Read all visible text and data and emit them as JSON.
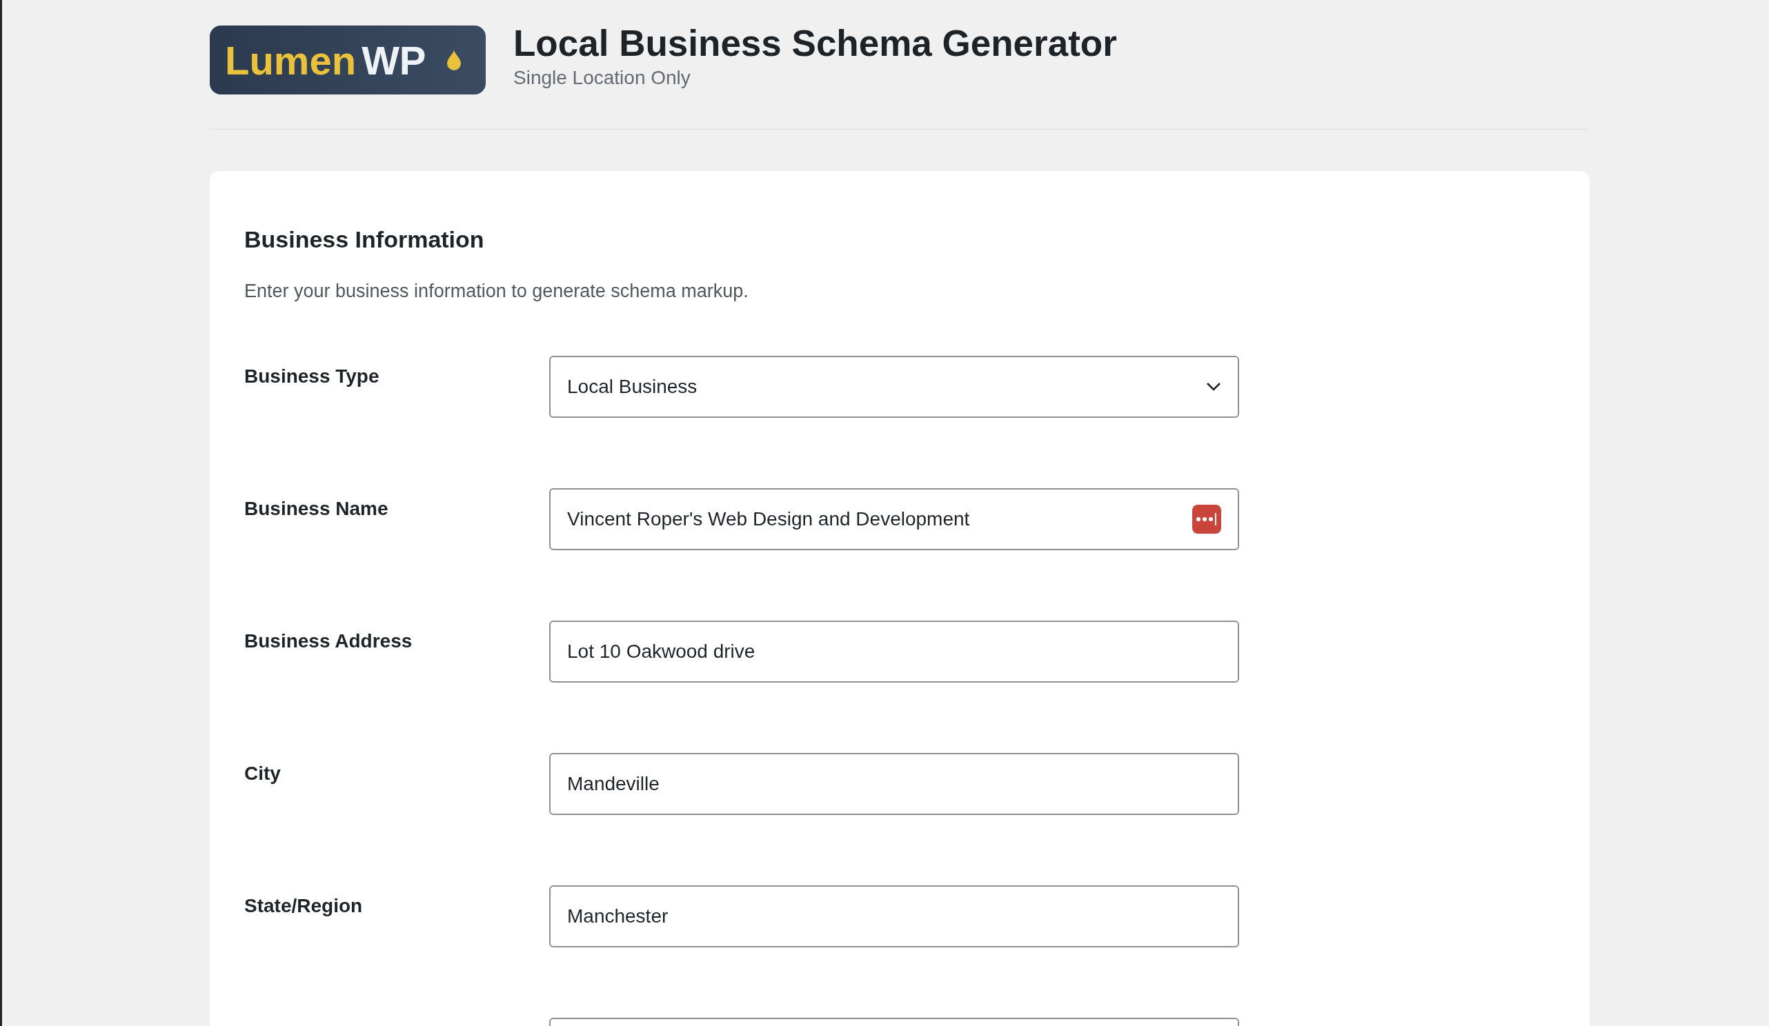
{
  "logo": {
    "word_1": "Lumen",
    "word_2": "WP"
  },
  "header": {
    "title": "Local Business Schema Generator",
    "subtitle": "Single Location Only"
  },
  "section": {
    "title": "Business Information",
    "description": "Enter your business information to generate schema markup."
  },
  "fields": [
    {
      "kind": "select",
      "label": "Business Type",
      "value": "Local Business",
      "autofill_icon": false
    },
    {
      "kind": "text",
      "label": "Business Name",
      "value": "Vincent Roper's Web Design and Development",
      "autofill_icon": true
    },
    {
      "kind": "text",
      "label": "Business Address",
      "value": "Lot 10 Oakwood drive",
      "autofill_icon": false
    },
    {
      "kind": "text",
      "label": "City",
      "value": "Mandeville",
      "autofill_icon": false
    },
    {
      "kind": "text",
      "label": "State/Region",
      "value": "Manchester",
      "autofill_icon": false
    },
    {
      "kind": "text"
    }
  ]
}
